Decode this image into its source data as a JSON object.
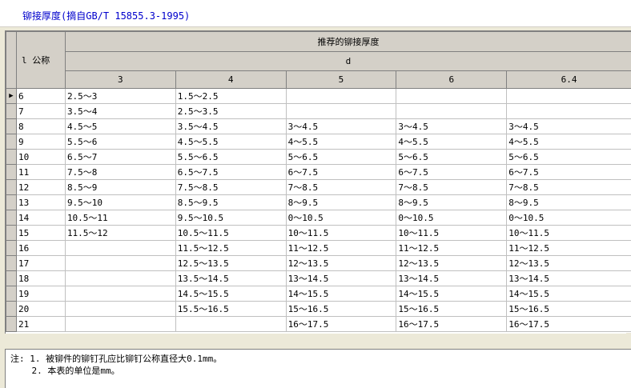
{
  "window": {
    "title": "铆接厚度(摘自GB/T 15855.3-1995)"
  },
  "table": {
    "nominal_header": "l 公称",
    "group_header": "推荐的铆接厚度",
    "sub_header": "d",
    "columns": [
      "3",
      "4",
      "5",
      "6",
      "6.4"
    ],
    "rows": [
      {
        "l": "6",
        "cells": [
          "2.5～3",
          "1.5～2.5",
          "",
          "",
          ""
        ]
      },
      {
        "l": "7",
        "cells": [
          "3.5～4",
          "2.5～3.5",
          "",
          "",
          ""
        ]
      },
      {
        "l": "8",
        "cells": [
          "4.5～5",
          "3.5～4.5",
          "3～4.5",
          "3～4.5",
          "3～4.5"
        ]
      },
      {
        "l": "9",
        "cells": [
          "5.5～6",
          "4.5～5.5",
          "4～5.5",
          "4～5.5",
          "4～5.5"
        ]
      },
      {
        "l": "10",
        "cells": [
          "6.5～7",
          "5.5～6.5",
          "5～6.5",
          "5～6.5",
          "5～6.5"
        ]
      },
      {
        "l": "11",
        "cells": [
          "7.5～8",
          "6.5～7.5",
          "6～7.5",
          "6～7.5",
          "6～7.5"
        ]
      },
      {
        "l": "12",
        "cells": [
          "8.5～9",
          "7.5～8.5",
          "7～8.5",
          "7～8.5",
          "7～8.5"
        ]
      },
      {
        "l": "13",
        "cells": [
          "9.5～10",
          "8.5～9.5",
          "8～9.5",
          "8～9.5",
          "8～9.5"
        ]
      },
      {
        "l": "14",
        "cells": [
          "10.5～11",
          "9.5～10.5",
          "0～10.5",
          "0～10.5",
          "0～10.5"
        ]
      },
      {
        "l": "15",
        "cells": [
          "11.5～12",
          "10.5～11.5",
          "10～11.5",
          "10～11.5",
          "10～11.5"
        ]
      },
      {
        "l": "16",
        "cells": [
          "",
          "11.5～12.5",
          "11～12.5",
          "11～12.5",
          "11～12.5"
        ]
      },
      {
        "l": "17",
        "cells": [
          "",
          "12.5～13.5",
          "12～13.5",
          "12～13.5",
          "12～13.5"
        ]
      },
      {
        "l": "18",
        "cells": [
          "",
          "13.5～14.5",
          "13～14.5",
          "13～14.5",
          "13～14.5"
        ]
      },
      {
        "l": "19",
        "cells": [
          "",
          "14.5～15.5",
          "14～15.5",
          "14～15.5",
          "14～15.5"
        ]
      },
      {
        "l": "20",
        "cells": [
          "",
          "15.5～16.5",
          "15～16.5",
          "15～16.5",
          "15～16.5"
        ]
      },
      {
        "l": "21",
        "cells": [
          "",
          "",
          "16～17.5",
          "16～17.5",
          "16～17.5"
        ]
      }
    ],
    "current_row_marker": "▶"
  },
  "notes": [
    "注: 1. 被铆件的铆钉孔应比铆钉公称直径大0.1mm。",
    "    2. 本表的单位是mm。"
  ]
}
